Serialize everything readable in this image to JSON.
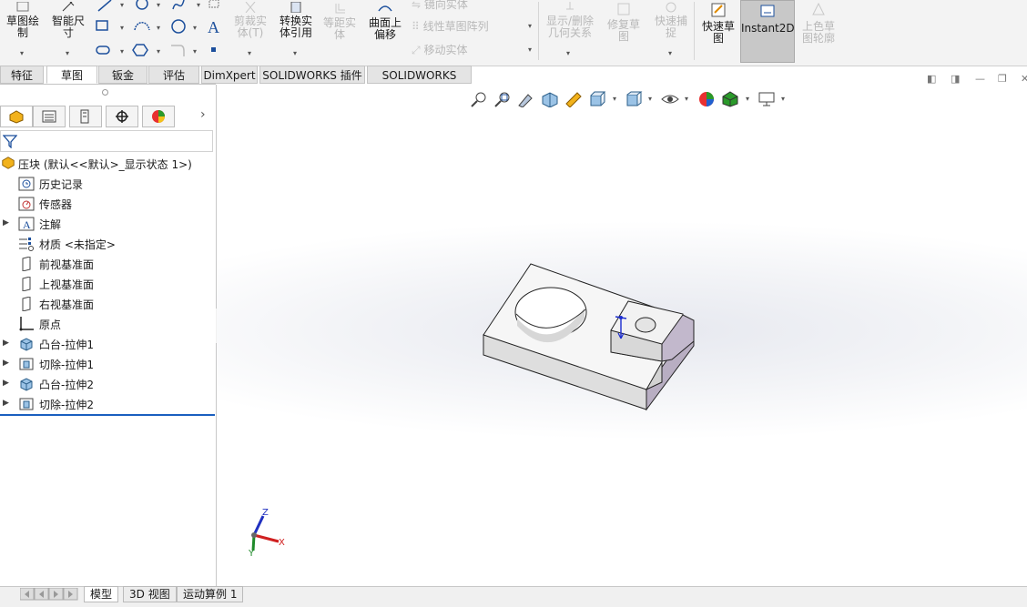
{
  "ribbon": {
    "sketch": "草图绘\n制",
    "smart_dim": "智能尺\n寸",
    "trim": "剪裁实\n体(T)",
    "convert": "转换实\n体引用",
    "offset": "等距实\n体",
    "surface_offset": "曲面上\n偏移",
    "mirror": "镜向实体",
    "linear_pattern": "线性草图阵列",
    "move": "移动实体",
    "display_relations": "显示/删除\n几何关系",
    "repair": "修复草\n图",
    "quick_snap": "快速捕\n捉",
    "rapid_sketch": "快速草\n图",
    "instant2d": "Instant2D",
    "shaded_contours": "上色草\n图轮廓"
  },
  "tabs": [
    "特征",
    "草图",
    "钣金",
    "评估",
    "DimXpert",
    "SOLIDWORKS 插件",
    "SOLIDWORKS MBD"
  ],
  "active_tab": "草图",
  "tree": {
    "root": "压块  (默认<<默认>_显示状态 1>)",
    "items": [
      {
        "label": "历史记录",
        "icon": "history-icon",
        "expandable": false
      },
      {
        "label": "传感器",
        "icon": "sensor-icon",
        "expandable": false
      },
      {
        "label": "注解",
        "icon": "annotation-icon",
        "expandable": true
      },
      {
        "label": "材质 <未指定>",
        "icon": "material-icon",
        "expandable": false
      },
      {
        "label": "前视基准面",
        "icon": "plane-icon",
        "expandable": false
      },
      {
        "label": "上视基准面",
        "icon": "plane-icon",
        "expandable": false
      },
      {
        "label": "右视基准面",
        "icon": "plane-icon",
        "expandable": false
      },
      {
        "label": "原点",
        "icon": "origin-icon",
        "expandable": false
      },
      {
        "label": "凸台-拉伸1",
        "icon": "boss-extrude-icon",
        "expandable": true
      },
      {
        "label": "切除-拉伸1",
        "icon": "cut-extrude-icon",
        "expandable": true
      },
      {
        "label": "凸台-拉伸2",
        "icon": "boss-extrude-icon",
        "expandable": true
      },
      {
        "label": "切除-拉伸2",
        "icon": "cut-extrude-icon",
        "expandable": true
      }
    ]
  },
  "triad": {
    "x": "X",
    "y": "Y",
    "z": "Z"
  },
  "bottom_tabs": [
    "模型",
    "3D 视图",
    "运动算例 1"
  ],
  "active_bottom_tab": "模型",
  "colors": {
    "accent": "#1a5fbf",
    "instant2d_bg": "#c8c8c8",
    "x_axis": "#d02020",
    "y_axis": "#1f8a2a",
    "z_axis": "#2030c0"
  }
}
